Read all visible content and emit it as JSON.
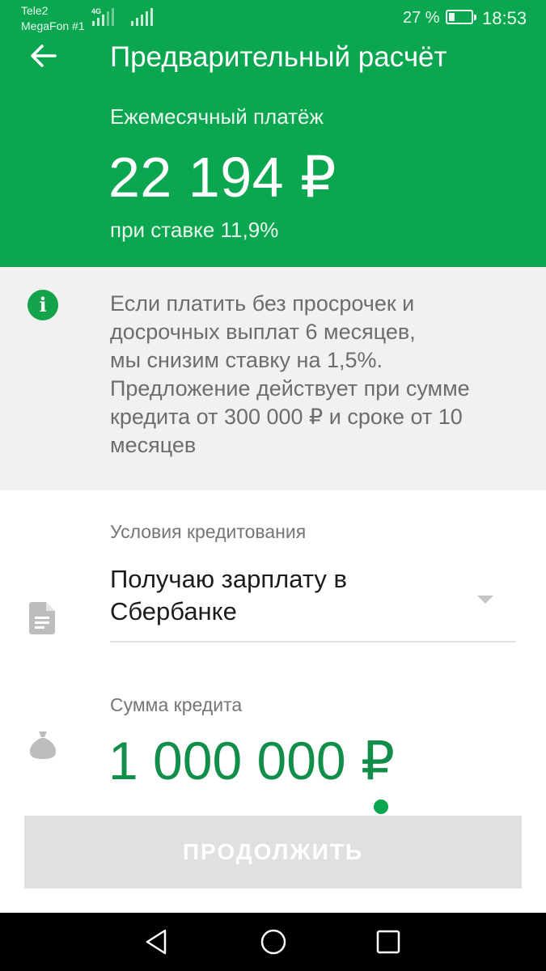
{
  "status_bar": {
    "carrier_1": "Tele2",
    "carrier_2": "MegaFon #1",
    "network_type": "4G",
    "battery_percent": "27 %",
    "battery_level": 0.27,
    "time": "18:53"
  },
  "header": {
    "title": "Предварительный расчёт",
    "payment_label": "Ежемесячный платёж",
    "payment_amount": "22 194 ₽",
    "rate_note": "при ставке 11,9%"
  },
  "info": {
    "icon": "info-icon",
    "lines": [
      "Если платить без просрочек и",
      "досрочных выплат 6 месяцев,",
      "мы снизим ставку на 1,5%.",
      "Предложение действует при сумме",
      "кредита от 300 000 ₽ и сроке от 10",
      "месяцев"
    ]
  },
  "form": {
    "conditions_label": "Условия кредитования",
    "conditions_value_lines": [
      "Получаю зарплату в",
      "Сбербанке"
    ],
    "sum_label": "Сумма кредита",
    "sum_value": "1 000 000 ₽"
  },
  "actions": {
    "continue_label": "ПРОДОЛЖИТЬ"
  },
  "colors": {
    "brand_green": "#0aa650",
    "amount_green": "#118e49",
    "disabled_button": "#e0e0e0"
  }
}
